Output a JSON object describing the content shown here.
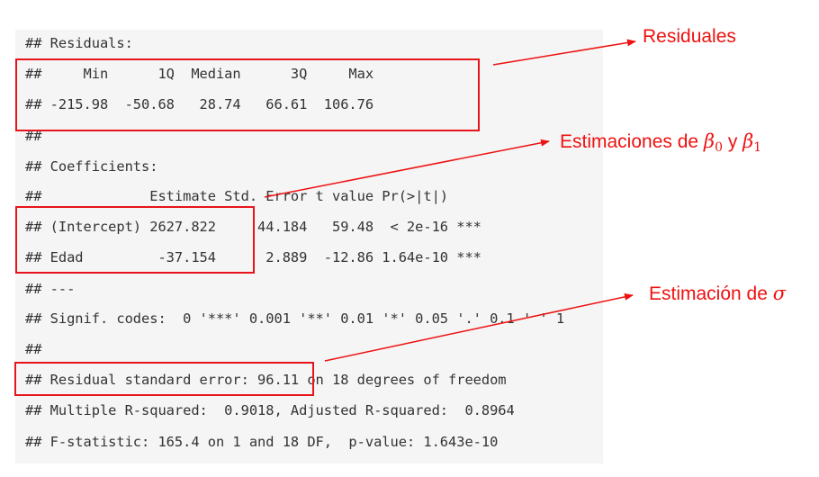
{
  "output": {
    "lines": [
      "## Residuals:",
      "##     Min      1Q  Median      3Q     Max",
      "## -215.98  -50.68   28.74   66.61  106.76",
      "##",
      "## Coefficients:",
      "##             Estimate Std. Error t value Pr(>|t|)",
      "## (Intercept) 2627.822     44.184   59.48  < 2e-16 ***",
      "## Edad         -37.154      2.889  -12.86 1.64e-10 ***",
      "## ---",
      "## Signif. codes:  0 '***' 0.001 '**' 0.01 '*' 0.05 '.' 0.1 ' ' 1",
      "##",
      "## Residual standard error: 96.11 on 18 degrees of freedom",
      "## Multiple R-squared:  0.9018, Adjusted R-squared:  0.8964",
      "## F-statistic: 165.4 on 1 and 18 DF,  p-value: 1.643e-10"
    ]
  },
  "annotations": {
    "residuales": {
      "label": "Residuales"
    },
    "betas": {
      "prefix": "Estimaciones de ",
      "beta0": "β",
      "beta0_sub": "0",
      "joiner": " y ",
      "beta1": "β",
      "beta1_sub": "1"
    },
    "sigma": {
      "prefix": "Estimación de ",
      "symbol": "σ"
    }
  },
  "colors": {
    "annotation": "#ee1111",
    "code_background": "#f5f5f5",
    "code_text": "#333333"
  }
}
